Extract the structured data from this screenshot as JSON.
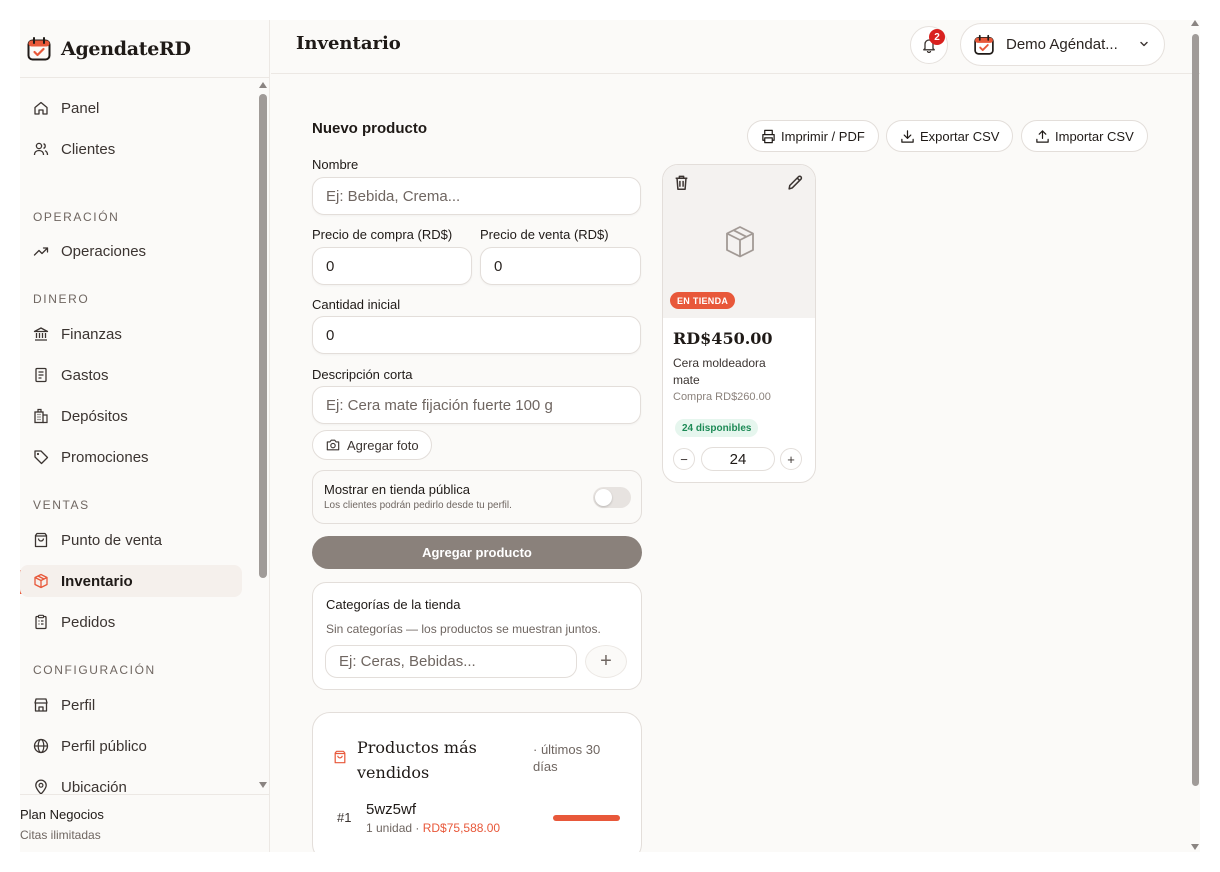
{
  "app": {
    "brand": "AgendateRD",
    "accent_color": "#e8583a"
  },
  "sidebar": {
    "items_top": [
      {
        "label": "Panel",
        "icon": "home-icon"
      },
      {
        "label": "Clientes",
        "icon": "users-icon"
      }
    ],
    "sections": [
      {
        "title": "OPERACIÓN",
        "items": [
          {
            "label": "Operaciones",
            "icon": "trending-up-icon"
          }
        ]
      },
      {
        "title": "DINERO",
        "items": [
          {
            "label": "Finanzas",
            "icon": "bank-icon"
          },
          {
            "label": "Gastos",
            "icon": "receipt-icon"
          },
          {
            "label": "Depósitos",
            "icon": "building-icon"
          },
          {
            "label": "Promociones",
            "icon": "tag-icon"
          }
        ]
      },
      {
        "title": "VENTAS",
        "items": [
          {
            "label": "Punto de venta",
            "icon": "shopping-bag-icon"
          },
          {
            "label": "Inventario",
            "icon": "box-icon",
            "active": true
          },
          {
            "label": "Pedidos",
            "icon": "clipboard-icon"
          }
        ]
      },
      {
        "title": "CONFIGURACIÓN",
        "items": [
          {
            "label": "Perfil",
            "icon": "store-icon"
          },
          {
            "label": "Perfil público",
            "icon": "globe-icon"
          },
          {
            "label": "Ubicación",
            "icon": "map-pin-icon"
          }
        ]
      }
    ],
    "plan": {
      "name": "Plan Negocios",
      "description": "Citas ilimitadas"
    }
  },
  "header": {
    "title": "Inventario",
    "notifications_count": "2",
    "account_name": "Demo Agéndat..."
  },
  "form": {
    "title": "Nuevo producto",
    "name_label": "Nombre",
    "name_placeholder": "Ej: Bebida, Crema...",
    "buy_price_label": "Precio de compra (RD$)",
    "buy_price_value": "0",
    "sell_price_label": "Precio de venta (RD$)",
    "sell_price_value": "0",
    "initial_qty_label": "Cantidad inicial",
    "initial_qty_value": "0",
    "short_desc_label": "Descripción corta",
    "short_desc_placeholder": "Ej: Cera mate fijación fuerte 100 g",
    "add_photo_label": "Agregar foto",
    "public_toggle_title": "Mostrar en tienda pública",
    "public_toggle_subtitle": "Los clientes podrán pedirlo desde tu perfil.",
    "public_toggle_on": false,
    "submit_label": "Agregar producto"
  },
  "categories": {
    "title": "Categorías de la tienda",
    "empty_text": "Sin categorías — los productos se muestran juntos.",
    "input_placeholder": "Ej: Ceras, Bebidas...",
    "add_label": "+"
  },
  "top_products": {
    "title": "Productos más vendidos",
    "period": "· últimos 30 días",
    "items": [
      {
        "rank": "#1",
        "name": "5wz5wf",
        "units": "1 unidad",
        "separator": " · ",
        "amount": "RD$75,588.00",
        "share": 1.0
      }
    ]
  },
  "actions": {
    "print_label": "Imprimir / PDF",
    "export_label": "Exportar CSV",
    "import_label": "Importar CSV"
  },
  "product": {
    "badge": "EN TIENDA",
    "price": "RD$450.00",
    "name": "Cera moldeadora mate",
    "buy_price": "Compra RD$260.00",
    "stock": "24 disponibles",
    "qty": "24",
    "minus": "−",
    "plus": "+"
  }
}
